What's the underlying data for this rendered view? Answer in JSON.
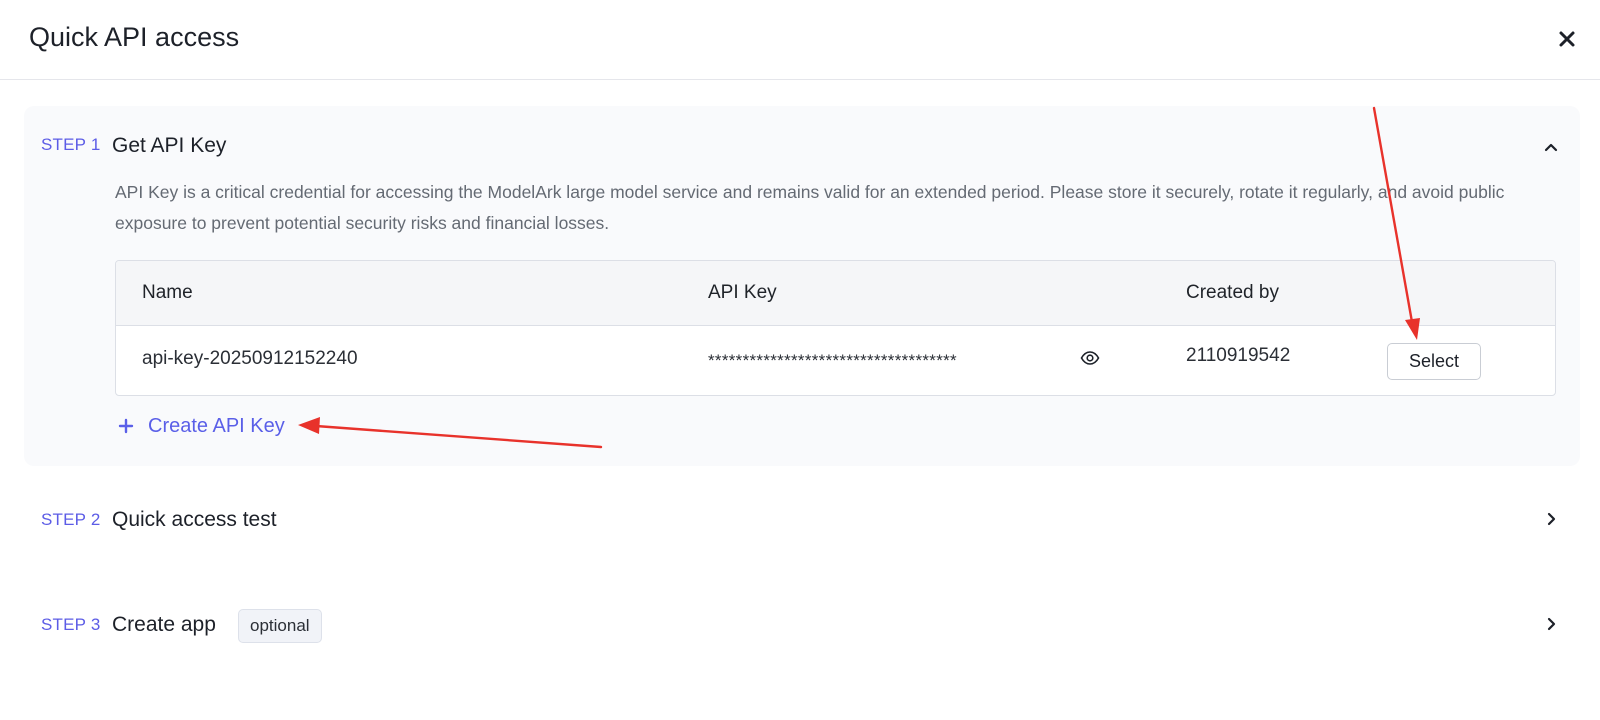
{
  "modal": {
    "title": "Quick API access"
  },
  "steps": [
    {
      "label": "STEP 1",
      "title": "Get API Key",
      "expanded": true,
      "description": "API Key is a critical credential for accessing the ModelArk large model service and remains valid for an extended period. Please store it securely, rotate it regularly, and avoid public exposure to prevent potential security risks and financial losses.",
      "table": {
        "columns": [
          "Name",
          "API Key",
          "Created by"
        ],
        "rows": [
          {
            "name": "api-key-20250912152240",
            "api_key": "************************************",
            "created_by": "2110919542",
            "action_label": "Select"
          }
        ]
      },
      "create_label": "Create API Key"
    },
    {
      "label": "STEP 2",
      "title": "Quick access test",
      "expanded": false
    },
    {
      "label": "STEP 3",
      "title": "Create app",
      "badge": "optional",
      "expanded": false
    }
  ],
  "colors": {
    "accent": "#5a5fe8",
    "annotation_arrow": "#e8322b"
  },
  "icons": {
    "close": "close-icon",
    "collapse": "chevron-up-icon",
    "expand": "chevron-right-icon",
    "reveal": "eye-icon",
    "add": "plus-icon"
  }
}
